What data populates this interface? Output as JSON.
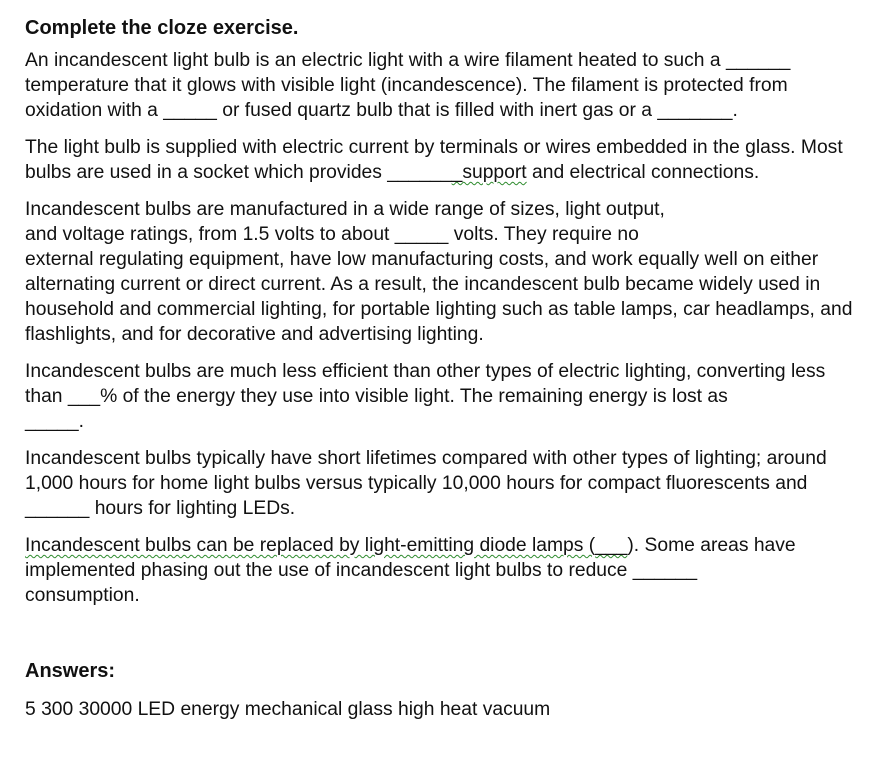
{
  "title": "Complete the cloze exercise.",
  "p1": {
    "a": "An incandescent light bulb is an electric light with a wire filament heated to such a ",
    "blank1": "______",
    "b": "temperature that it glows with visible light (incandescence). The filament is protected from oxidation with a ",
    "blank2": "_____",
    "c": " or fused quartz bulb that is filled with inert gas or a ",
    "blank3": "_______",
    "d": "."
  },
  "p2": {
    "a": "The light bulb is supplied with electric current by terminals or wires embedded in the glass. Most bulbs are used in a socket which provides ",
    "blank1": "______",
    "b": "_support",
    "c": " and electrical connections."
  },
  "p3": {
    "a": "Incandescent bulbs are manufactured in a wide range of sizes, light output,",
    "b": "and voltage ratings, from 1.5 volts to about ",
    "blank1": "_____",
    "c": " volts. They require no",
    "d": "external regulating equipment, have low manufacturing costs, and work equally well on either alternating current or direct current. As a result, the incandescent bulb became widely used in household and commercial lighting, for portable lighting such as table lamps, car headlamps, and flashlights, and for decorative and advertising lighting."
  },
  "p4": {
    "a": "Incandescent bulbs are much less efficient than other types of electric lighting, converting less than ",
    "blank1": "___",
    "b": "% of the energy they use into visible light. The remaining energy is lost as",
    "blank2": "_____",
    "c": "."
  },
  "p5": {
    "a": "Incandescent bulbs typically have short lifetimes compared with other types of lighting; around 1,000 hours for home light bulbs versus typically 10,000 hours for compact fluorescents and ",
    "blank1": "______",
    "b": " hours for lighting LEDs."
  },
  "p6": {
    "a": "Incandescent bulbs can be replaced by light-emitting diode lamps (",
    "blank1": "___",
    "b": "). Some areas have implemented phasing out the use of incandescent light bulbs to reduce ",
    "blank2": "______",
    "c": "consumption."
  },
  "answers": {
    "title": "Answers:",
    "text": "5 300 30000 LED energy mechanical glass high heat vacuum"
  }
}
